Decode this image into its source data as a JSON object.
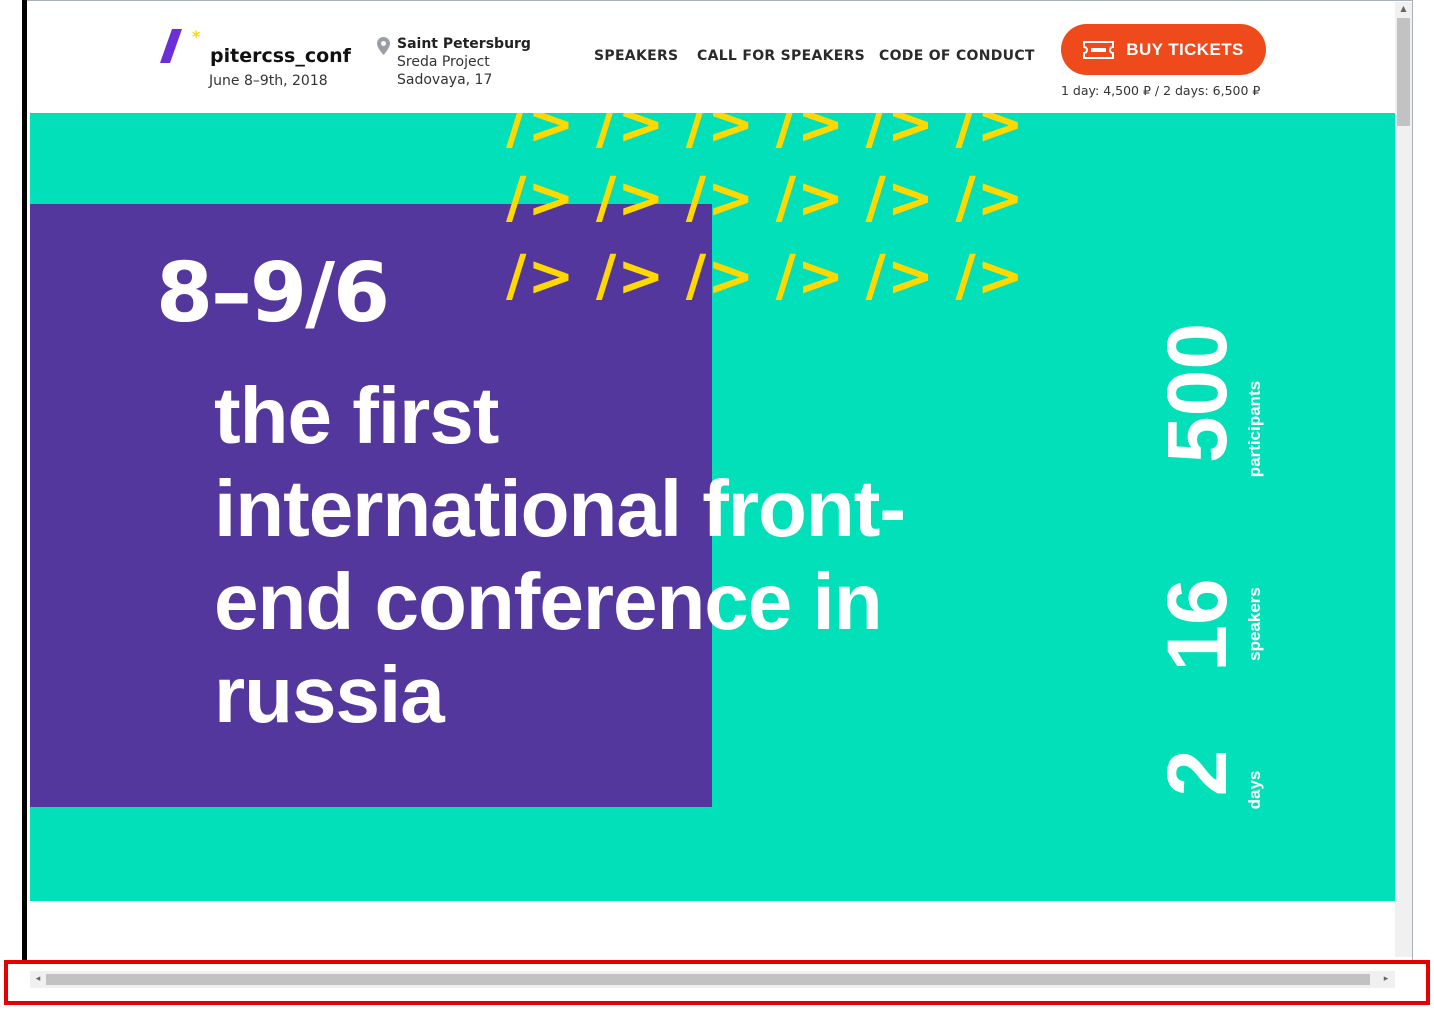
{
  "header": {
    "logo_text": "pitercss_conf",
    "dates": "June 8–9th, 2018",
    "location": {
      "city": "Saint Petersburg",
      "venue": "Sreda Project",
      "address": "Sadovaya, 17"
    },
    "nav": [
      "SPEAKERS",
      "CALL FOR SPEAKERS",
      "CODE OF CONDUCT"
    ],
    "buy_label": "BUY TICKETS",
    "prices": "1 day: 4,500 ₽ / 2 days: 6,500 ₽"
  },
  "hero": {
    "date": "8–9/6",
    "headline_lines": [
      "the first",
      "international front-",
      "end conference in",
      "russia"
    ],
    "slash_pattern": "/> /> /> /> /> />",
    "stats": [
      {
        "value": "500",
        "label": "participants"
      },
      {
        "value": "16",
        "label": "speakers"
      },
      {
        "value": "2",
        "label": "days"
      }
    ]
  },
  "colors": {
    "teal": "#01e0b8",
    "purple": "#53379c",
    "yellow": "#ffd800",
    "orange": "#ee4a1c",
    "highlight": "#e60000"
  },
  "icons": {
    "logo": "logo-slash-asterisk-icon",
    "location": "map-pin-icon",
    "ticket": "ticket-icon",
    "scroll_left": "scroll-left-arrow-icon",
    "scroll_right": "scroll-right-arrow-icon",
    "scroll_up": "scroll-up-arrow-icon"
  }
}
